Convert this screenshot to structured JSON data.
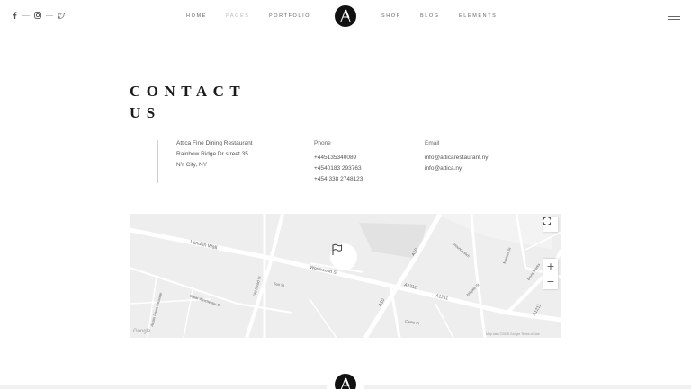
{
  "header": {
    "social": [
      "facebook-icon",
      "instagram-icon",
      "twitter-icon"
    ],
    "nav": [
      {
        "label": "HOME"
      },
      {
        "label": "PAGES"
      },
      {
        "label": "PORTFOLIO"
      },
      {
        "label": "SHOP"
      },
      {
        "label": "BLOG"
      },
      {
        "label": "ELEMENTS"
      }
    ],
    "logo_letter": "A"
  },
  "title": {
    "line1": "CONTACT",
    "line2": "US"
  },
  "address": {
    "line1": "Attica Fine Dining Restaurant",
    "line2": "Rainbow Ridge Dr street 35",
    "line3": "NY City, NY"
  },
  "phone": {
    "label": "Phone",
    "numbers": [
      "+445135340089",
      "+4540183 293763",
      "+454 338 2748123"
    ]
  },
  "email": {
    "label": "Email",
    "addresses": [
      "info@atticarestaurant.ny",
      "info@attica.ny"
    ]
  },
  "map": {
    "labels": {
      "london_wall": "London Wall",
      "wormwood": "Wormwood St",
      "a10_top": "A10",
      "a10_bottom": "A10",
      "a1211_a": "A1211",
      "a1211_b": "A1211",
      "a1211_c": "A1211",
      "old_broad": "Old Broad St",
      "great_winchester": "Great Winchester St",
      "austin_friars": "Austin Friars Passage",
      "houndsditch": "Houndsditch",
      "aldgate": "Aldgate St",
      "mansell": "Mansell St",
      "bevis_marks": "Bevis Marks",
      "clerks_pl": "Clerks Pl",
      "sun_st": "Sun St",
      "google": "Google",
      "footer": "Map data ©2018 Google   Terms of Use"
    },
    "zoom_in": "+",
    "zoom_out": "−"
  },
  "colors": {
    "accent": "#111111",
    "map_bg": "#eeeeee",
    "road": "#ffffff"
  }
}
